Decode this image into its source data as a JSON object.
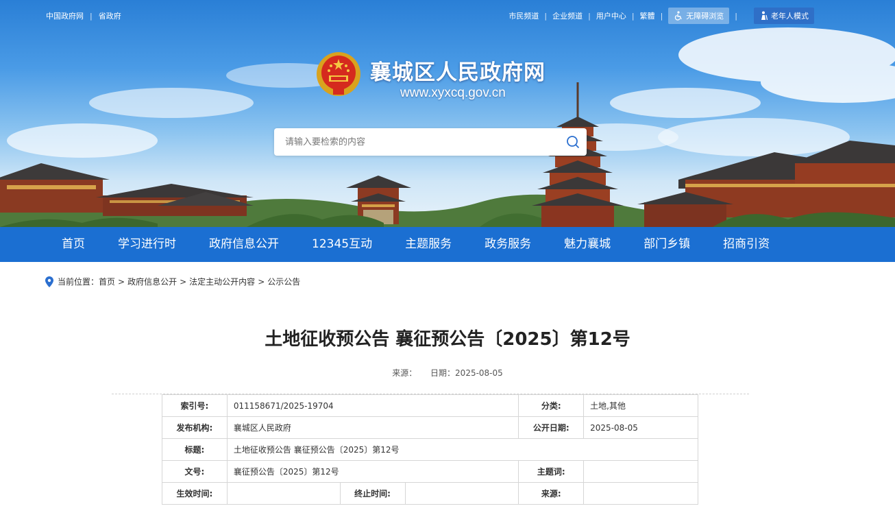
{
  "top": {
    "left_links": [
      "中国政府网",
      "省政府"
    ],
    "right_links": [
      "市民频道",
      "企业频道",
      "用户中心",
      "繁體"
    ],
    "accessibility_label": "无障碍浏览",
    "elder_label": "老年人模式"
  },
  "site": {
    "title": "襄城区人民政府网",
    "url": "www.xyxcq.gov.cn"
  },
  "search": {
    "placeholder": "请输入要检索的内容"
  },
  "nav": [
    "首页",
    "学习进行时",
    "政府信息公开",
    "12345互动",
    "主题服务",
    "政务服务",
    "魅力襄城",
    "部门乡镇",
    "招商引资"
  ],
  "breadcrumb": {
    "prefix": "当前位置：",
    "items": [
      "首页",
      "政府信息公开",
      "法定主动公开内容",
      "公示公告"
    ]
  },
  "document": {
    "title": "土地征收预公告 襄征预公告〔2025〕第12号",
    "source_label": "来源：",
    "date_label": "日期：",
    "date": "2025-08-05"
  },
  "info_table": {
    "index_label": "索引号:",
    "index_value": "011158671/2025-19704",
    "category_label": "分类:",
    "category_value": "土地,其他",
    "publisher_label": "发布机构:",
    "publisher_value": "襄城区人民政府",
    "pubdate_label": "公开日期:",
    "pubdate_value": "2025-08-05",
    "subject_label": "标题:",
    "subject_value": "土地征收预公告 襄征预公告〔2025〕第12号",
    "docno_label": "文号:",
    "docno_value": "襄征预公告〔2025〕第12号",
    "keywords_label": "主题词:",
    "keywords_value": "",
    "effective_label": "生效时间:",
    "effective_value": "",
    "expiry_label": "终止时间:",
    "expiry_value": "",
    "source_label": "来源:",
    "source_value": ""
  }
}
